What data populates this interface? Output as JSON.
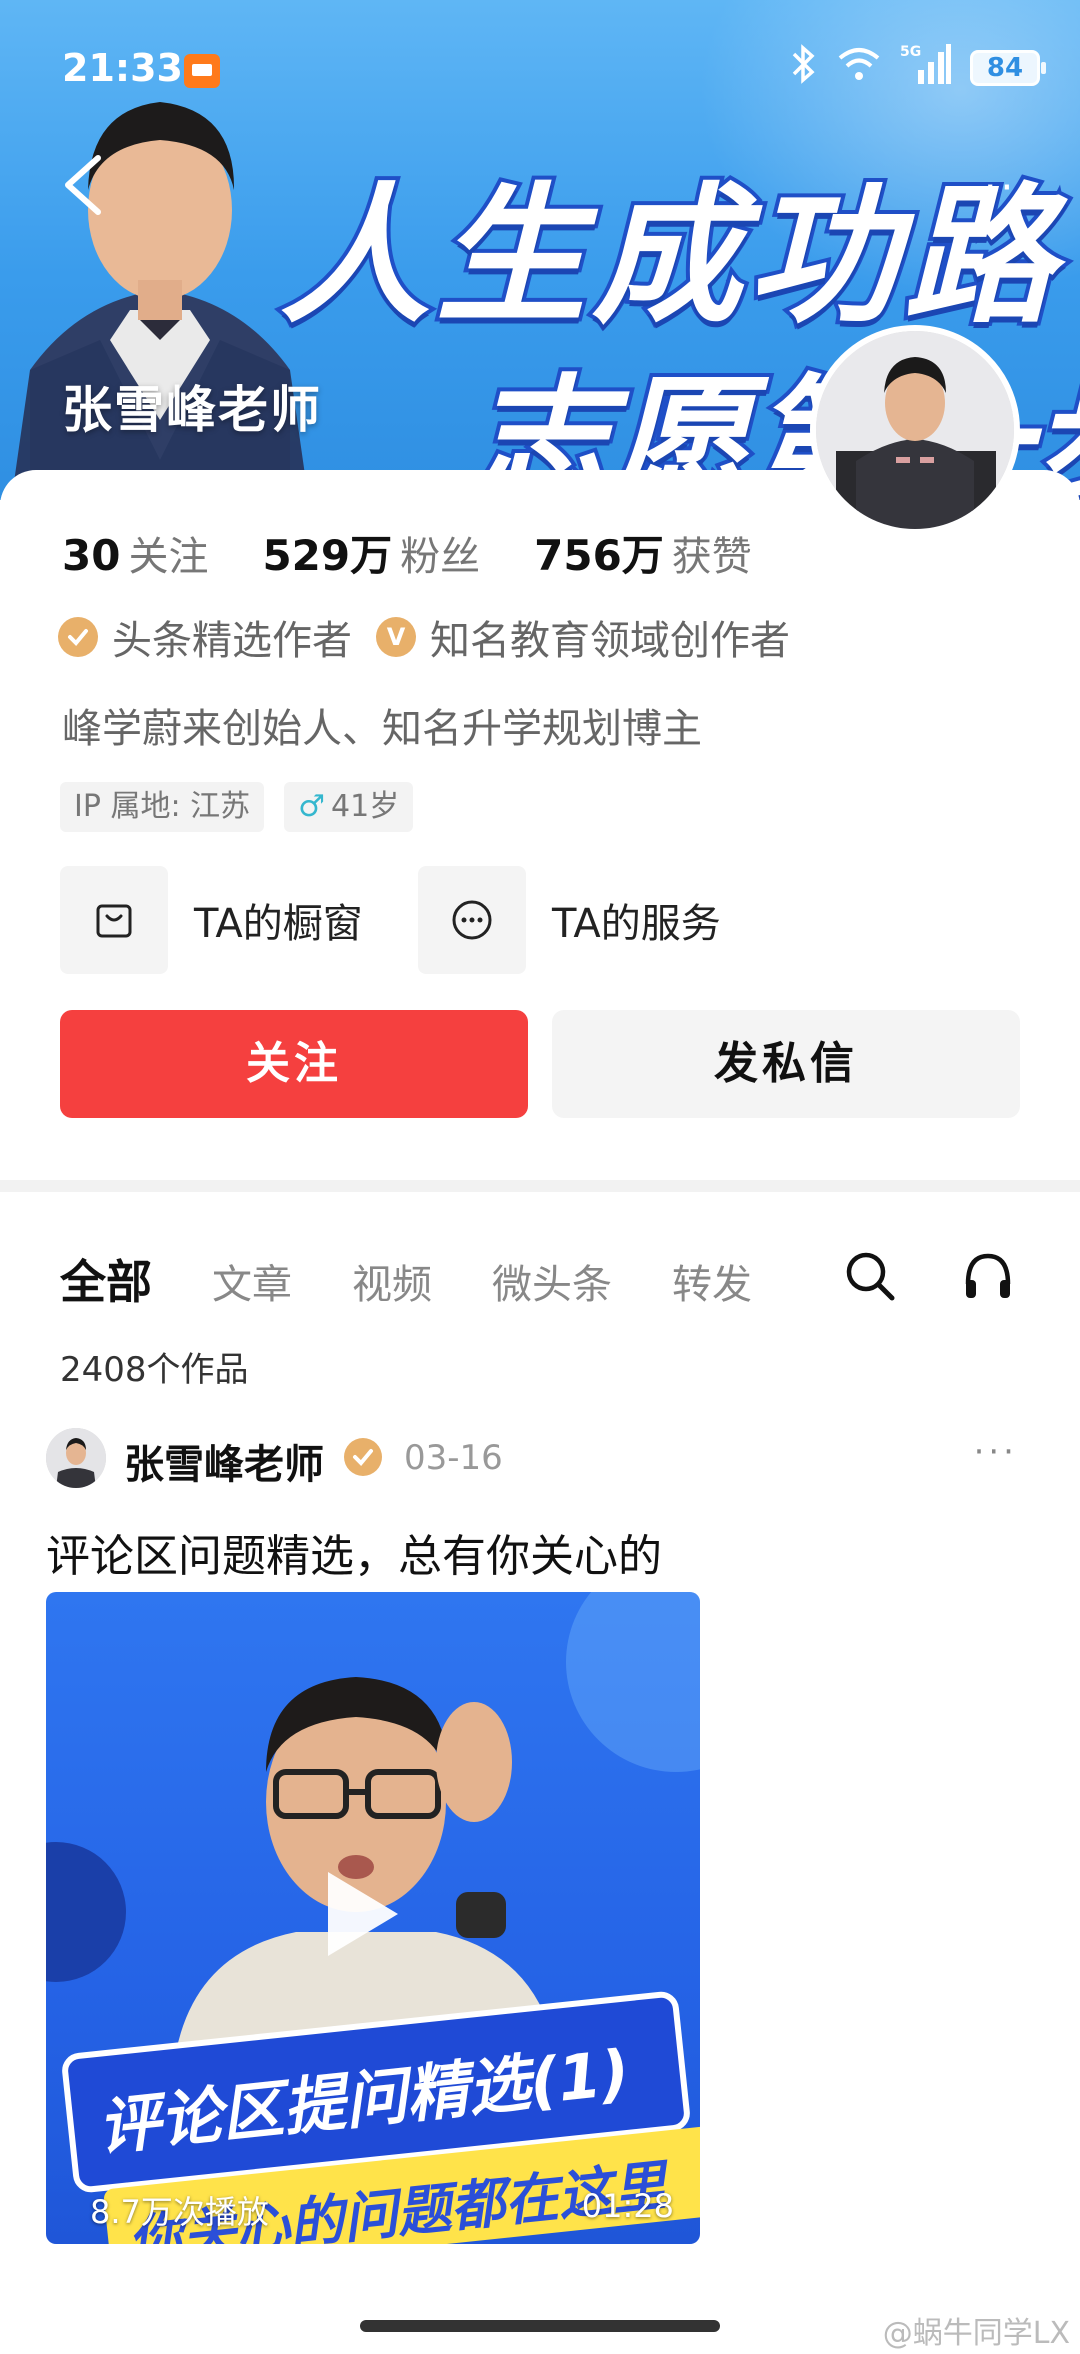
{
  "status_bar": {
    "time": "21:33",
    "network": "5G",
    "battery": "84"
  },
  "banner": {
    "title_line1": "人生成功路",
    "title_line2": "志愿第一步",
    "person_label": "张雪峰老师"
  },
  "profile": {
    "stats": [
      {
        "value": "30",
        "label": "关注"
      },
      {
        "value": "529万",
        "label": "粉丝"
      },
      {
        "value": "756万",
        "label": "获赞"
      }
    ],
    "badges": [
      {
        "icon": "verified-icon",
        "label": "头条精选作者"
      },
      {
        "icon": "v-icon",
        "label": "知名教育领域创作者"
      }
    ],
    "bio": "峰学蔚来创始人、知名升学规划博主",
    "tags": {
      "ip": "IP 属地: 江苏",
      "age": "41岁"
    },
    "services": [
      {
        "icon": "shop-bag-icon",
        "label": "TA的橱窗"
      },
      {
        "icon": "more-circle-icon",
        "label": "TA的服务"
      }
    ],
    "follow_label": "关注",
    "message_label": "发私信",
    "colors": {
      "follow": "#f5403f",
      "banner": "#3a9cec"
    }
  },
  "tabs": {
    "items": [
      "全部",
      "文章",
      "视频",
      "微头条",
      "转发"
    ],
    "active": "全部",
    "count": "2408个作品"
  },
  "post": {
    "author": "张雪峰老师",
    "date": "03-16",
    "title": "评论区问题精选，总有你关心的",
    "video": {
      "caption1": "评论区提问精选(1)",
      "caption2": "你关心的问题都在这里",
      "views": "8.7万次播放",
      "duration": "01:28"
    }
  },
  "watermark": "@蜗牛同学LX"
}
